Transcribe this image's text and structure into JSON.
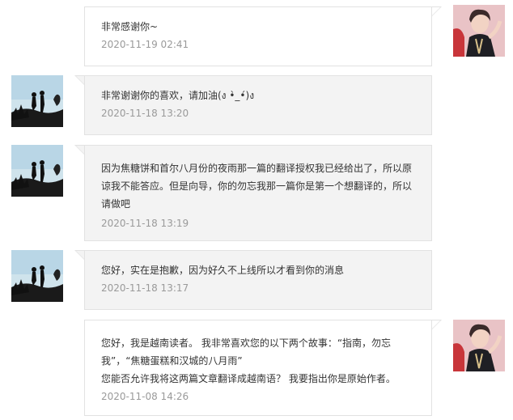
{
  "messages": [
    {
      "side": "right",
      "text": "非常感谢你~",
      "time": "2020-11-19 02:41"
    },
    {
      "side": "left",
      "text": "非常谢谢你的喜欢，请加油(ง •̀_•́)ง",
      "time": "2020-11-18 13:20"
    },
    {
      "side": "left",
      "text_lines": [
        "因为焦糖饼和首尔八月份的夜雨那一篇的翻译授权我已经给出了，所以原",
        "谅我不能答应。但是向导，你的勿忘我那一篇你是第一个想翻译的，所以",
        "请做吧"
      ],
      "time": "2020-11-18 13:19"
    },
    {
      "side": "left",
      "text": "您好，实在是抱歉，因为好久不上线所以才看到你的消息",
      "time": "2020-11-18 13:17"
    },
    {
      "side": "right",
      "text_lines": [
        "您好，我是越南读者。 我非常喜欢您的以下两个故事：“指南，勿忘",
        "我”，“焦糖蛋糕和汉城的八月雨”",
        "您能否允许我将这两篇文章翻译成越南语？ 我要指出你是原始作者。"
      ],
      "time": "2020-11-08 14:26"
    }
  ],
  "avatars": {
    "mine": "user-photo-avatar",
    "theirs": "silhouette-couple-avatar"
  }
}
